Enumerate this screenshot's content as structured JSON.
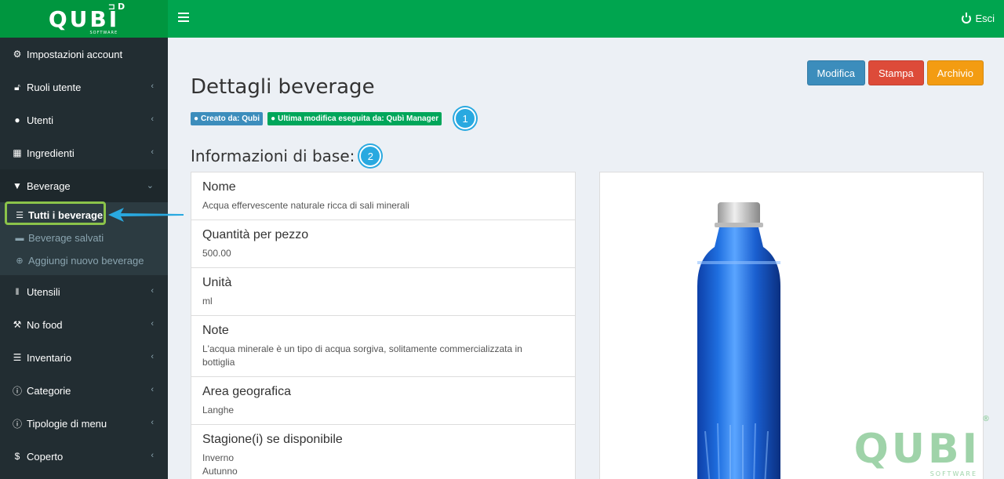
{
  "header": {
    "logo": "QUBI",
    "logo_sub": "SOFTWARE",
    "logout_label": "Esci"
  },
  "sidebar": {
    "items": [
      {
        "label": "Impostazioni account",
        "icon": "gear-icon"
      },
      {
        "label": "Ruoli utente",
        "icon": "unlock-icon"
      },
      {
        "label": "Utenti",
        "icon": "user-icon"
      },
      {
        "label": "Ingredienti",
        "icon": "cubes-icon"
      },
      {
        "label": "Beverage",
        "icon": "cocktail-icon"
      },
      {
        "label": "Utensili",
        "icon": "cutlery-icon"
      },
      {
        "label": "No food",
        "icon": "wrench-icon"
      },
      {
        "label": "Inventario",
        "icon": "list-icon"
      },
      {
        "label": "Categorie",
        "icon": "info-icon"
      },
      {
        "label": "Tipologie di menu",
        "icon": "info-icon"
      },
      {
        "label": "Coperto",
        "icon": "dollar-icon"
      }
    ],
    "beverage_submenu": [
      {
        "label": "Tutti i beverage",
        "icon": "list-icon"
      },
      {
        "label": "Beverage salvati",
        "icon": "archive-icon"
      },
      {
        "label": "Aggiungi nuovo beverage",
        "icon": "plus-circle-icon"
      }
    ]
  },
  "actions": {
    "edit": "Modifica",
    "print": "Stampa",
    "archive": "Archivio"
  },
  "page": {
    "title": "Dettagli beverage",
    "created_by": "Creato da: Qubi",
    "last_modified": "Ultima modifica eseguita da: Qubì Manager",
    "callout_1": "1",
    "section_title": "Informazioni di base:",
    "callout_2": "2"
  },
  "info": [
    {
      "label": "Nome",
      "value": "Acqua effervescente naturale ricca di sali minerali"
    },
    {
      "label": "Quantità per pezzo",
      "value": "500.00"
    },
    {
      "label": "Unità",
      "value": "ml"
    },
    {
      "label": "Note",
      "value": "L'acqua minerale è un tipo di acqua sorgiva, solitamente commercializzata in bottiglia"
    },
    {
      "label": "Area geografica",
      "value": "Langhe"
    },
    {
      "label": "Stagione(i) se disponibile",
      "value": "Inverno"
    },
    {
      "label": "",
      "value": "Autunno"
    }
  ],
  "watermark": {
    "logo": "QUBI",
    "sub": "SOFTWARE",
    "registered": "®"
  },
  "colors": {
    "brand_green": "#00a54f",
    "sidebar_bg": "#222d32",
    "highlight": "#8bc34a",
    "callout": "#29a9e0",
    "bottle_blue": "#1565c0"
  }
}
